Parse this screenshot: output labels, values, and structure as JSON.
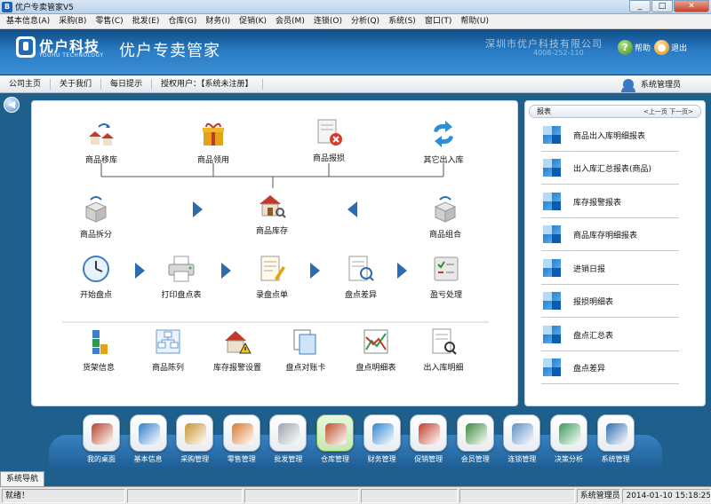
{
  "window": {
    "title": "优户专卖管家V5",
    "minimize": "_",
    "maximize": "□",
    "close": "✕"
  },
  "menu": [
    "基本信息(A)",
    "采购(B)",
    "零售(C)",
    "批发(E)",
    "仓库(G)",
    "财务(I)",
    "促销(K)",
    "会员(M)",
    "连锁(O)",
    "分析(Q)",
    "系统(S)",
    "窗口(T)",
    "帮助(U)"
  ],
  "banner": {
    "logo_text": "优户科技",
    "logo_sub": "YOUHU TECHNOLOGY",
    "app_name": "优户专卖管家",
    "company": "深圳市优户科技有限公司",
    "phone": "4008-252-110",
    "help_label": "帮助",
    "exit_label": "退出",
    "help_glyph": "?",
    "exit_glyph": "●"
  },
  "links": [
    "公司主页",
    "关于我们",
    "每日提示",
    "授权用户：【系统未注册】"
  ],
  "user": "系统管理员",
  "nav_back": "◀",
  "flow": {
    "top_row": [
      "商品移库",
      "商品领用",
      "商品报损",
      "其它出入库"
    ],
    "center": "商品库存",
    "split": "商品拆分",
    "combine": "商品组合",
    "count_row": [
      "开始盘点",
      "打印盘点表",
      "录盘点单",
      "盘点差异",
      "盈亏处理"
    ],
    "bottom_row": [
      "货架信息",
      "商品陈列",
      "库存报警设置",
      "盘点对账卡",
      "盘点明细表",
      "出入库明细"
    ]
  },
  "reports": {
    "title": "报表",
    "prev": "<上一页",
    "next": "下一页>",
    "items": [
      "商品出入库明细报表",
      "出入库汇总报表(商品)",
      "库存报警报表",
      "商品库存明细报表",
      "进销日报",
      "报损明细表",
      "盘点汇总表",
      "盘点差异"
    ]
  },
  "dock": {
    "items": [
      "我的桌面",
      "基本信息",
      "采购管理",
      "零售管理",
      "批发管理",
      "仓库管理",
      "财务管理",
      "促销管理",
      "会员管理",
      "连锁管理",
      "决策分析",
      "系统管理"
    ],
    "active": 5,
    "colors": [
      "#b8432a",
      "#2f7fc8",
      "#c9932d",
      "#d9782c",
      "#9aa3ac",
      "#c0502d",
      "#2f88d1",
      "#c23b2b",
      "#3a8a3a",
      "#5e8fc5",
      "#3a9a5a",
      "#2f6fb0"
    ]
  },
  "status": {
    "tab": "系统导航",
    "ready": "就绪！",
    "user": "系统管理员",
    "datetime": "2014-01-10 15:18:25"
  }
}
